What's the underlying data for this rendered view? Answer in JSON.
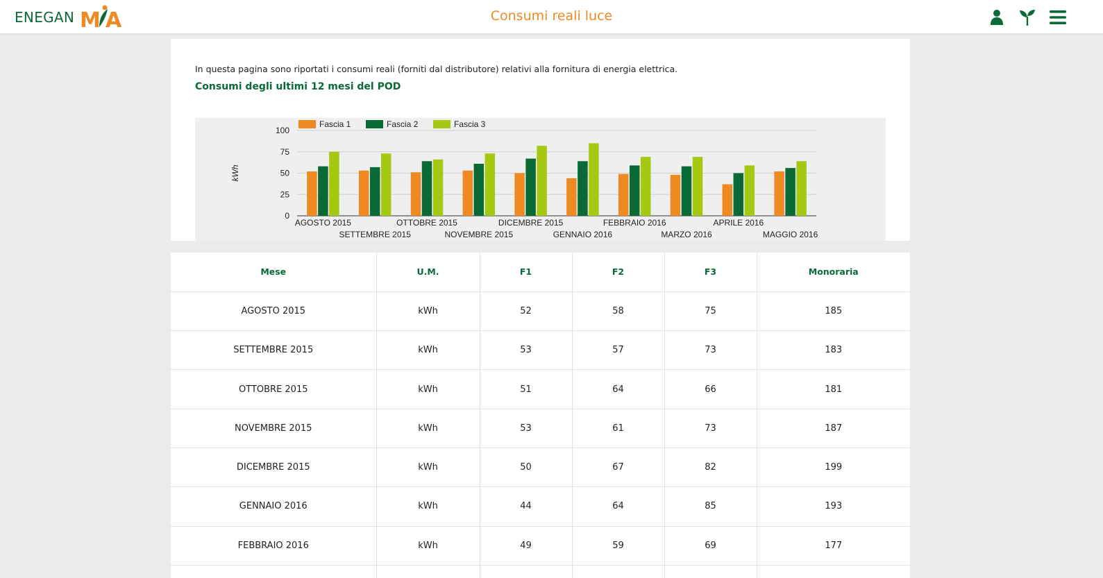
{
  "header": {
    "logo_text": "ENEGAN",
    "logo_mark": "MIA",
    "title": "Consumi reali luce",
    "icons": [
      "user-icon",
      "sprout-icon",
      "menu-icon"
    ]
  },
  "intro_text": "In questa pagina sono riportati i consumi reali (forniti dal distributore) relativi alla fornitura di energia elettrica.",
  "subtitle": "Consumi degli ultimi 12 mesi del POD",
  "colors": {
    "fascia1": "#ef8a22",
    "fascia2": "#0a6a35",
    "fascia3": "#a5c812",
    "brand_green": "#0a6a35",
    "brand_orange": "#ef8a22"
  },
  "chart_data": {
    "type": "bar",
    "ylabel": "kWh",
    "ylim": [
      0,
      100
    ],
    "yticks": [
      0,
      25,
      50,
      75,
      100
    ],
    "legend_position": "top-left",
    "grid": true,
    "categories": [
      "AGOSTO 2015",
      "SETTEMBRE 2015",
      "OTTOBRE 2015",
      "NOVEMBRE 2015",
      "DICEMBRE 2015",
      "GENNAIO 2016",
      "FEBBRAIO 2016",
      "MARZO 2016",
      "APRILE 2016",
      "MAGGIO 2016"
    ],
    "series": [
      {
        "name": "Fascia 1",
        "color": "#ef8a22",
        "values": [
          52,
          53,
          51,
          53,
          50,
          44,
          49,
          48,
          37,
          52
        ]
      },
      {
        "name": "Fascia 2",
        "color": "#0a6a35",
        "values": [
          58,
          57,
          64,
          61,
          67,
          64,
          59,
          58,
          50,
          56
        ]
      },
      {
        "name": "Fascia 3",
        "color": "#a5c812",
        "values": [
          75,
          73,
          66,
          73,
          82,
          85,
          69,
          69,
          59,
          64
        ]
      }
    ]
  },
  "table": {
    "headers": [
      "Mese",
      "U.M.",
      "F1",
      "F2",
      "F3",
      "Monoraria"
    ],
    "rows": [
      [
        "AGOSTO 2015",
        "kWh",
        "52",
        "58",
        "75",
        "185"
      ],
      [
        "SETTEMBRE 2015",
        "kWh",
        "53",
        "57",
        "73",
        "183"
      ],
      [
        "OTTOBRE 2015",
        "kWh",
        "51",
        "64",
        "66",
        "181"
      ],
      [
        "NOVEMBRE 2015",
        "kWh",
        "53",
        "61",
        "73",
        "187"
      ],
      [
        "DICEMBRE 2015",
        "kWh",
        "50",
        "67",
        "82",
        "199"
      ],
      [
        "GENNAIO 2016",
        "kWh",
        "44",
        "64",
        "85",
        "193"
      ],
      [
        "FEBBRAIO 2016",
        "kWh",
        "49",
        "59",
        "69",
        "177"
      ],
      [
        "",
        "",
        "",
        "",
        "",
        ""
      ]
    ]
  }
}
